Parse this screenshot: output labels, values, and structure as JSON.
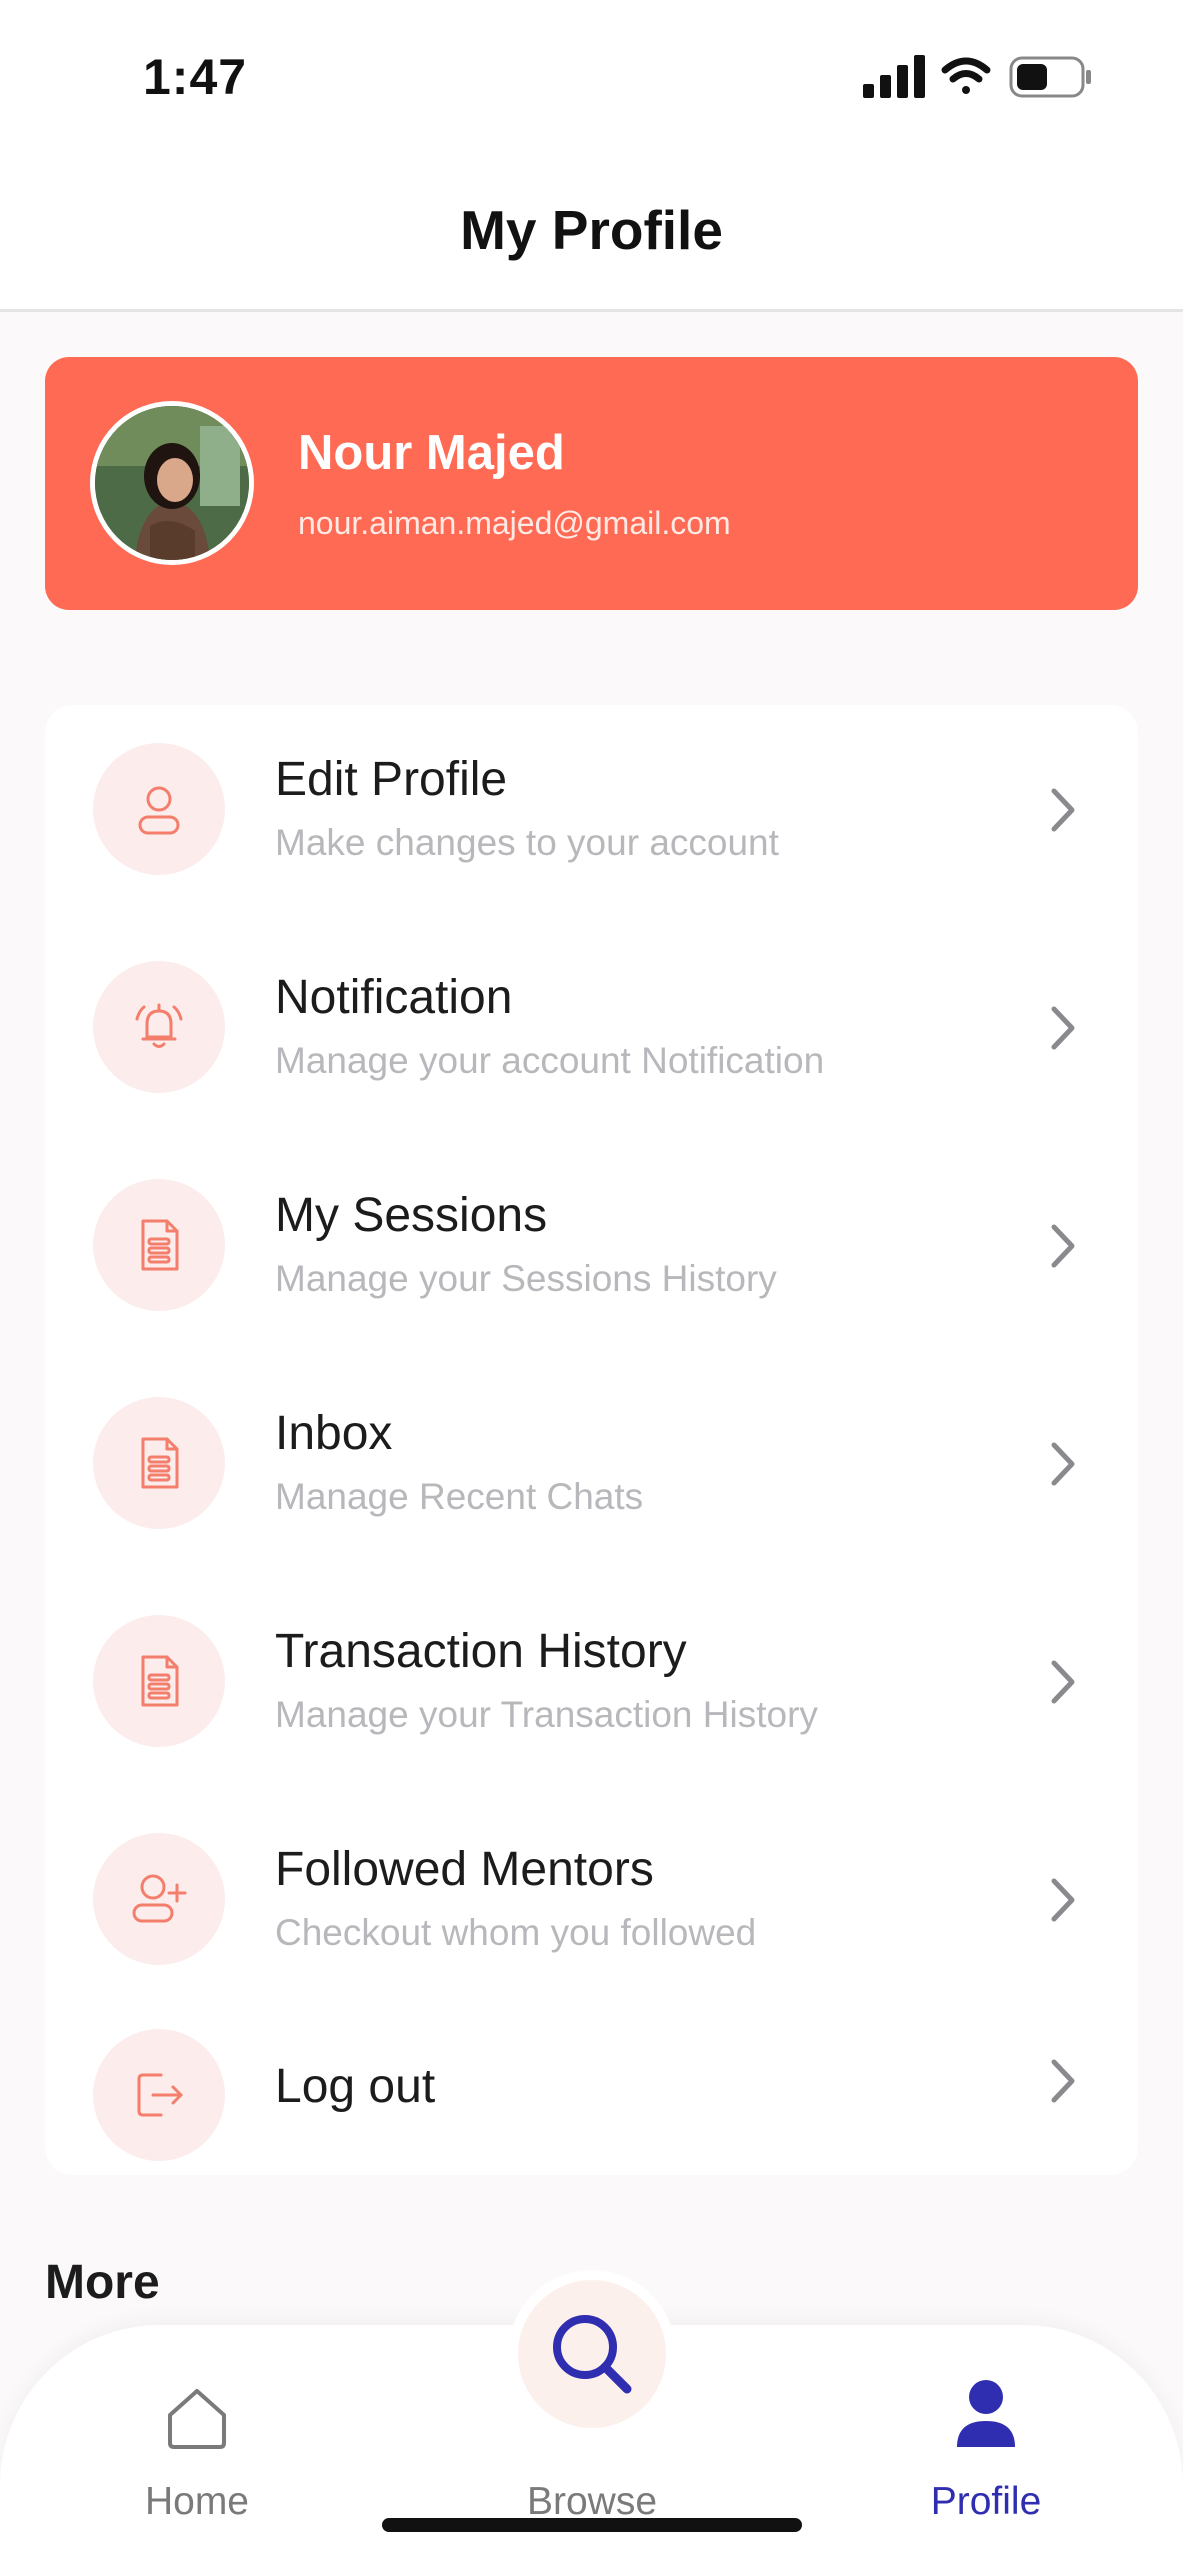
{
  "status_bar": {
    "time": "1:47"
  },
  "header": {
    "title": "My Profile"
  },
  "profile": {
    "name": "Nour Majed",
    "email": "nour.aiman.majed@gmail.com"
  },
  "menu": {
    "items": [
      {
        "title": "Edit Profile",
        "subtitle": "Make changes to your account",
        "icon": "user-icon"
      },
      {
        "title": "Notification",
        "subtitle": "Manage your account Notification",
        "icon": "bell-icon"
      },
      {
        "title": "My Sessions",
        "subtitle": "Manage your Sessions History",
        "icon": "document-icon"
      },
      {
        "title": "Inbox",
        "subtitle": "Manage Recent Chats",
        "icon": "document-icon"
      },
      {
        "title": "Transaction History",
        "subtitle": "Manage your Transaction History",
        "icon": "document-icon"
      },
      {
        "title": "Followed Mentors",
        "subtitle": "Checkout whom you followed",
        "icon": "user-add-icon"
      },
      {
        "title": "Log out",
        "subtitle": "",
        "icon": "logout-icon"
      }
    ]
  },
  "more": {
    "label": "More"
  },
  "tab_bar": {
    "home": "Home",
    "browse": "Browse",
    "profile": "Profile",
    "active": "profile"
  },
  "colors": {
    "accent": "#fe6a53",
    "icon_bg": "#fcecec",
    "active_tab": "#2f2db0"
  }
}
